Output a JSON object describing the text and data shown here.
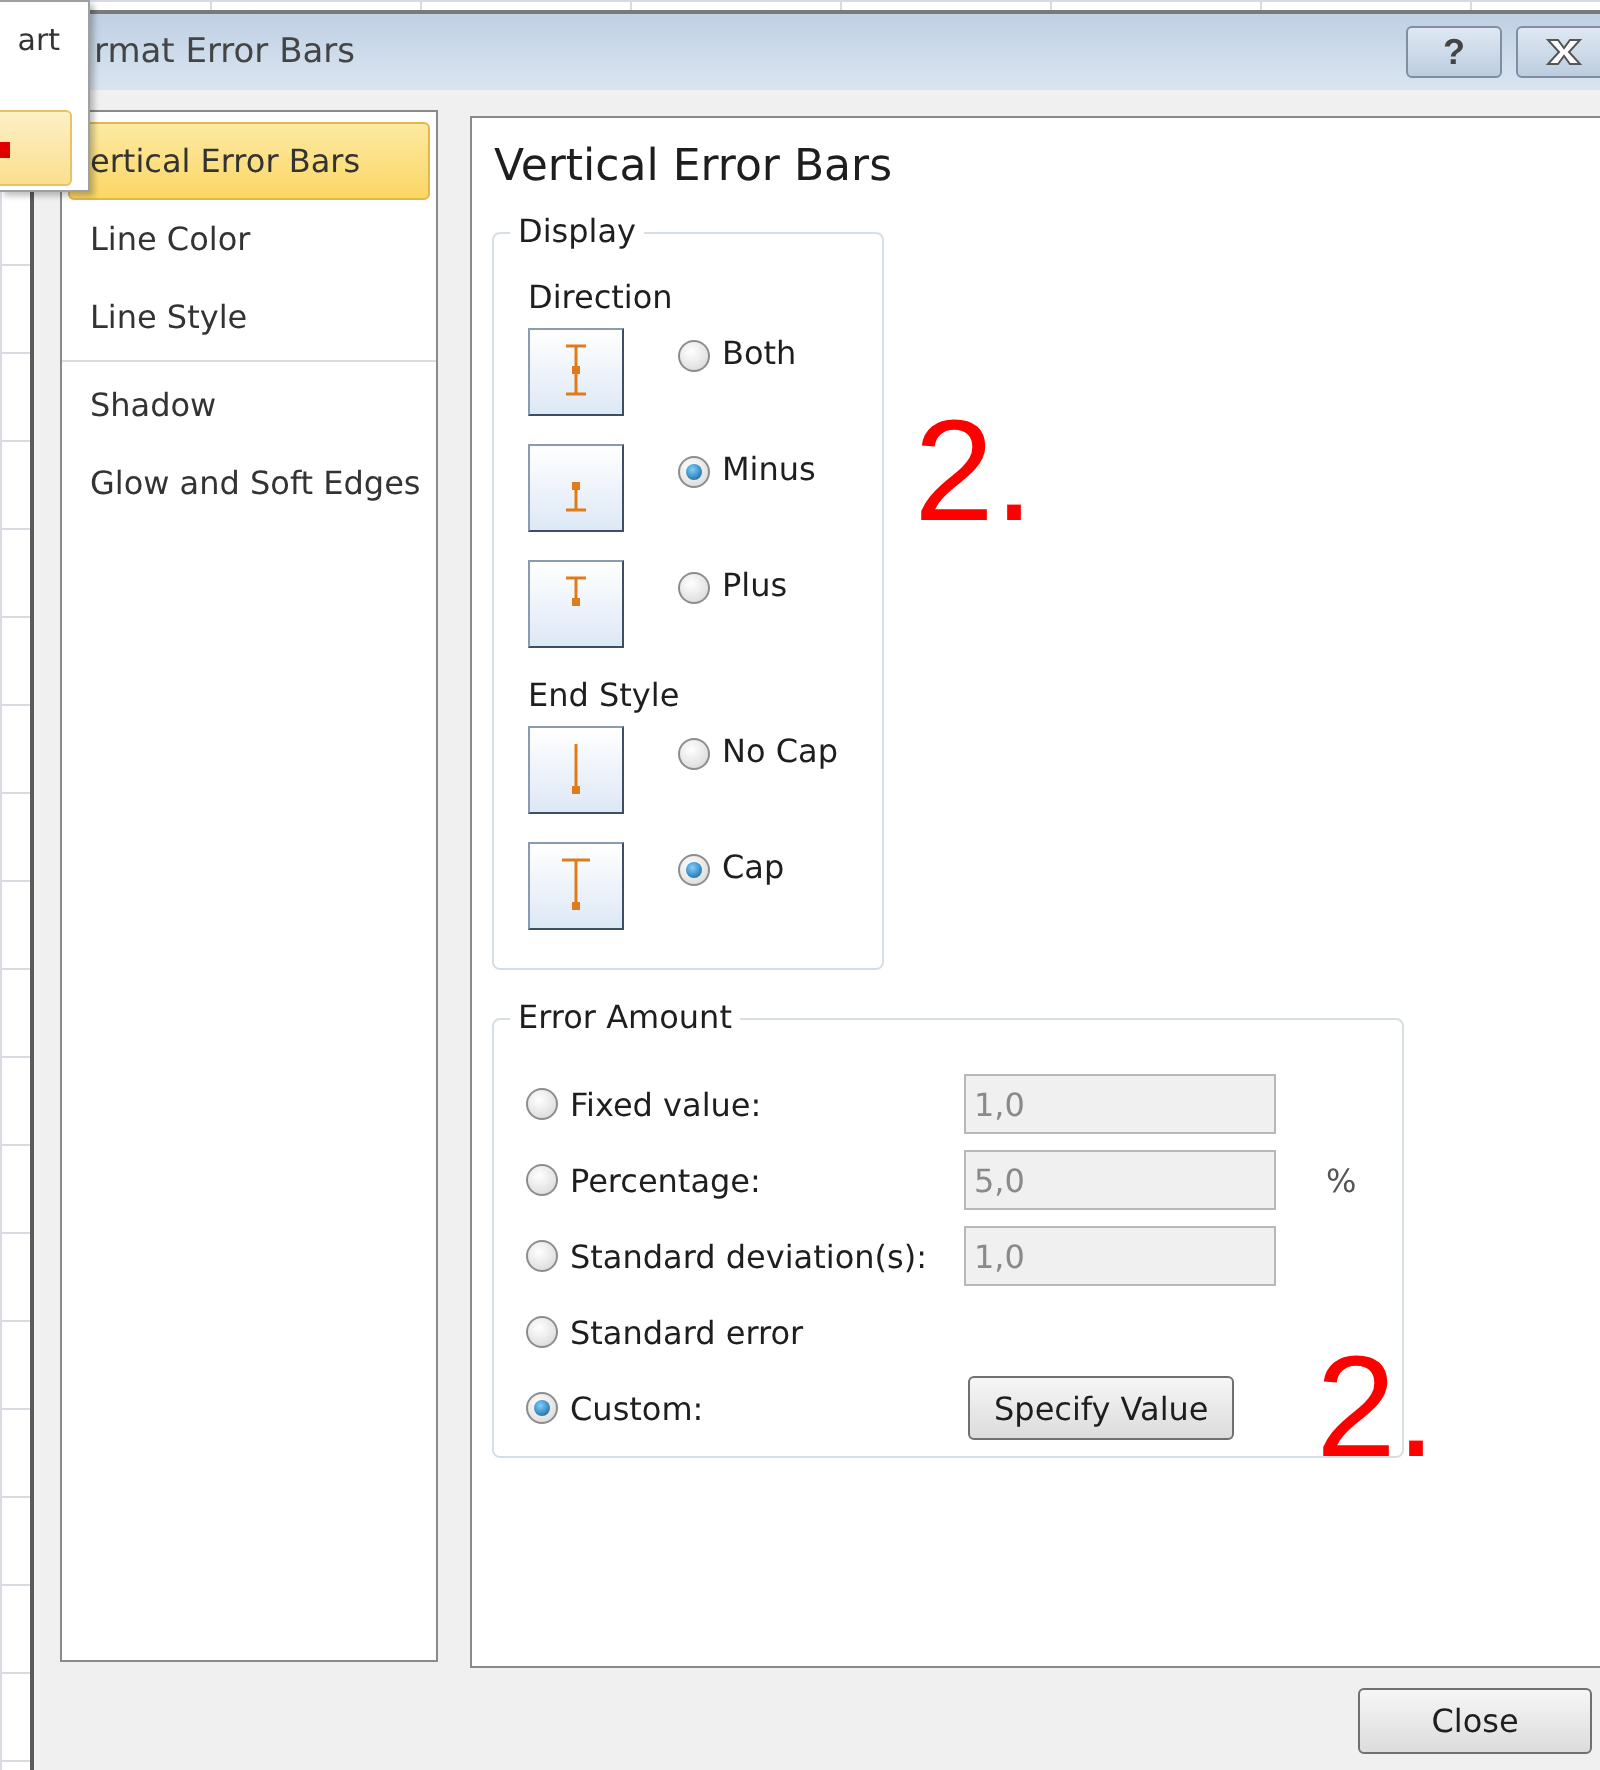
{
  "popup_menu": {
    "items": [
      {
        "label": "art",
        "selected": false
      },
      {
        "selected": true
      }
    ]
  },
  "window": {
    "title": "rmat Error Bars",
    "help": "?"
  },
  "sidebar": {
    "items": [
      {
        "label": "ertical Error Bars",
        "selected": true
      },
      {
        "label": "Line Color",
        "selected": false
      },
      {
        "label": "Line Style",
        "selected": false
      },
      {
        "label": "Shadow",
        "selected": false
      },
      {
        "label": "Glow and Soft Edges",
        "selected": false
      }
    ]
  },
  "panel": {
    "title": "Vertical Error Bars",
    "display": {
      "legend": "Display",
      "direction": {
        "label": "Direction",
        "options": [
          {
            "kind": "both",
            "label": "Both",
            "selected": false
          },
          {
            "kind": "minus",
            "label": "Minus",
            "selected": true
          },
          {
            "kind": "plus",
            "label": "Plus",
            "selected": false
          }
        ]
      },
      "end_style": {
        "label": "End Style",
        "options": [
          {
            "kind": "nocap",
            "label": "No Cap",
            "selected": false
          },
          {
            "kind": "cap",
            "label": "Cap",
            "selected": true
          }
        ]
      }
    },
    "error_amount": {
      "legend": "Error Amount",
      "options": [
        {
          "kind": "input",
          "label": "Fixed value:",
          "value": "1,0",
          "disabled": true,
          "selected": false
        },
        {
          "kind": "input",
          "label": "Percentage:",
          "value": "5,0",
          "unit": "%",
          "disabled": true,
          "selected": false
        },
        {
          "kind": "input",
          "label": "Standard deviation(s):",
          "value": "1,0",
          "disabled": true,
          "selected": false
        },
        {
          "kind": "plain",
          "label": "Standard error",
          "selected": false
        },
        {
          "kind": "button",
          "label": "Custom:",
          "button": "Specify Value",
          "selected": true
        }
      ]
    }
  },
  "annotations": [
    "2.",
    "2."
  ],
  "buttons": [
    "Close"
  ]
}
